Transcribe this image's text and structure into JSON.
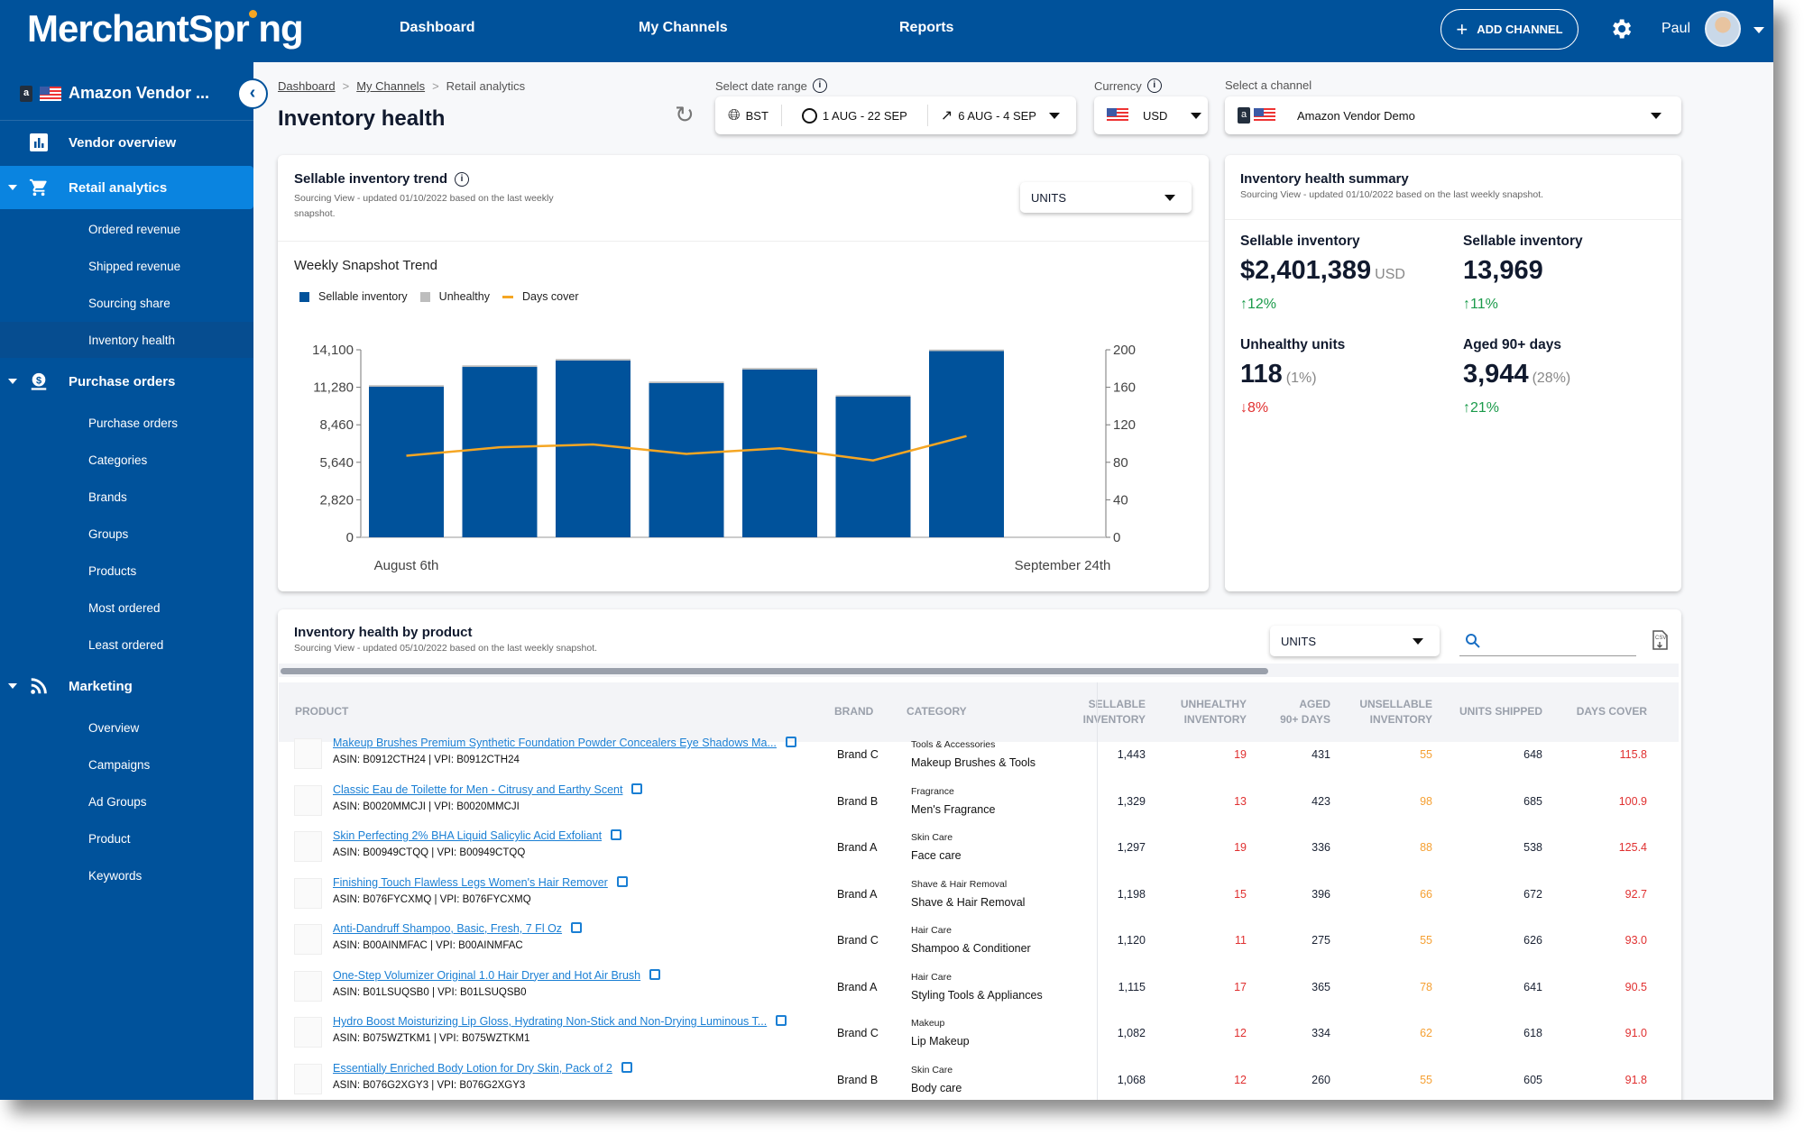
{
  "header": {
    "logo": "MerchantSpr ng",
    "nav": [
      "Dashboard",
      "My Channels",
      "Reports"
    ],
    "add_channel": "ADD CHANNEL",
    "user": "Paul"
  },
  "sidebar": {
    "channel": "Amazon Vendor ...",
    "sections": [
      {
        "label": "Vendor overview",
        "icon": "bar-chart-icon",
        "items": []
      },
      {
        "label": "Retail analytics",
        "icon": "cart-icon",
        "active": true,
        "items": [
          "Ordered revenue",
          "Shipped revenue",
          "Sourcing share",
          "Inventory health"
        ]
      },
      {
        "label": "Purchase orders",
        "icon": "money-bag-icon",
        "items": [
          "Purchase orders",
          "Categories",
          "Brands",
          "Groups",
          "Products",
          "Most ordered",
          "Least ordered"
        ]
      },
      {
        "label": "Marketing",
        "icon": "rss-icon",
        "items": [
          "Overview",
          "Campaigns",
          "Ad Groups",
          "Product",
          "Keywords"
        ]
      }
    ],
    "current_item": "Inventory health"
  },
  "breadcrumb": [
    "Dashboard",
    "My Channels",
    "Retail analytics"
  ],
  "page_title": "Inventory health",
  "filters": {
    "date_label": "Select date range",
    "timezone": "BST",
    "range": "1 AUG - 22 SEP",
    "compare": "6 AUG - 4 SEP",
    "currency_label": "Currency",
    "currency": "USD",
    "channel_label": "Select a channel",
    "channel": "Amazon Vendor Demo"
  },
  "trend_card": {
    "title": "Sellable inventory trend",
    "subtitle": "Sourcing View - updated 01/10/2022 based on the last weekly snapshot.",
    "units": "UNITS",
    "chart_title": "Weekly Snapshot Trend"
  },
  "chart_data": {
    "type": "bar",
    "title": "Weekly Snapshot Trend",
    "legend": [
      "Sellable inventory",
      "Unhealthy",
      "Days cover"
    ],
    "legend_position": "top-left",
    "categories": [
      "August 6th",
      "",
      "",
      "",
      "",
      "",
      "September 24th"
    ],
    "x_tick_labels": [
      "August 6th",
      "September 24th"
    ],
    "series": [
      {
        "name": "Sellable inventory",
        "type": "bar",
        "axis": "left",
        "values": [
          11320,
          12810,
          13290,
          11590,
          12610,
          10580,
          14000
        ]
      },
      {
        "name": "Unhealthy",
        "type": "bar",
        "axis": "left",
        "stacked": true,
        "values": [
          120,
          120,
          120,
          120,
          120,
          110,
          118
        ]
      },
      {
        "name": "Days cover",
        "type": "line",
        "axis": "right",
        "values": [
          87,
          96,
          99,
          89,
          95,
          82,
          108
        ]
      }
    ],
    "y_left": {
      "ticks": [
        0,
        2820,
        5640,
        8460,
        11280,
        14100
      ],
      "tick_labels": [
        "0",
        "2,820",
        "5,640",
        "8,460",
        "11,280",
        "14,100"
      ],
      "range": [
        0,
        14100
      ]
    },
    "y_right": {
      "ticks": [
        0,
        40,
        80,
        120,
        160,
        200
      ],
      "tick_labels": [
        "0",
        "40",
        "80",
        "120",
        "160",
        "200"
      ],
      "range": [
        0,
        200
      ]
    },
    "colors": {
      "Sellable inventory": "#00529b",
      "Unhealthy": "#bdbdbd",
      "Days cover": "#f5a623"
    },
    "grid": false
  },
  "summary": {
    "title": "Inventory health summary",
    "subtitle": "Sourcing View - updated 01/10/2022 based on the last weekly snapshot.",
    "kpis": [
      {
        "label": "Sellable inventory",
        "value": "$2,401,389",
        "unit": "USD",
        "change": "12%",
        "dir": "up"
      },
      {
        "label": "Sellable inventory",
        "value": "13,969",
        "unit": "",
        "change": "11%",
        "dir": "up"
      },
      {
        "label": "Unhealthy units",
        "value": "118",
        "unit": "(1%)",
        "change": "8%",
        "dir": "down"
      },
      {
        "label": "Aged 90+ days",
        "value": "3,944",
        "unit": "(28%)",
        "change": "21%",
        "dir": "up"
      }
    ]
  },
  "product_table": {
    "title": "Inventory health by product",
    "subtitle": "Sourcing View - updated 05/10/2022 based on the last weekly snapshot.",
    "units": "UNITS",
    "search_placeholder": "",
    "columns": [
      "PRODUCT",
      "BRAND",
      "CATEGORY",
      "SELLABLE INVENTORY",
      "UNHEALTHY INVENTORY",
      "AGED 90+ DAYS",
      "UNSELLABLE INVENTORY",
      "UNITS SHIPPED",
      "DAYS COVER"
    ],
    "columns_split": [
      [
        "PRODUCT"
      ],
      [
        "BRAND"
      ],
      [
        "CATEGORY"
      ],
      [
        "SELLABLE",
        "INVENTORY"
      ],
      [
        "UNHEALTHY",
        "INVENTORY"
      ],
      [
        "AGED",
        "90+ DAYS"
      ],
      [
        "UNSELLABLE",
        "INVENTORY"
      ],
      [
        "UNITS SHIPPED"
      ],
      [
        "DAYS COVER"
      ]
    ],
    "rows": [
      {
        "name": "Makeup Brushes Premium Synthetic Foundation Powder Concealers Eye Shadows Ma...",
        "ids": "ASIN: B0912CTH24 | VPI: B0912CTH24",
        "brand": "Brand C",
        "cat": "Tools & Accessories",
        "subcat": "Makeup Brushes & Tools",
        "sellable": "1,443",
        "unhealthy": "19",
        "aged": "431",
        "unsellable": "55",
        "shipped": "648",
        "cover": "115.8"
      },
      {
        "name": "Classic Eau de Toilette for Men - Citrusy and Earthy Scent",
        "ids": "ASIN: B0020MMCJI | VPI: B0020MMCJI",
        "brand": "Brand B",
        "cat": "Fragrance",
        "subcat": "Men's Fragrance",
        "sellable": "1,329",
        "unhealthy": "13",
        "aged": "423",
        "unsellable": "98",
        "shipped": "685",
        "cover": "100.9"
      },
      {
        "name": "Skin Perfecting 2% BHA Liquid Salicylic Acid Exfoliant",
        "ids": "ASIN: B00949CTQQ | VPI: B00949CTQQ",
        "brand": "Brand A",
        "cat": "Skin Care",
        "subcat": "Face care",
        "sellable": "1,297",
        "unhealthy": "19",
        "aged": "336",
        "unsellable": "88",
        "shipped": "538",
        "cover": "125.4"
      },
      {
        "name": "Finishing Touch Flawless Legs Women's Hair Remover",
        "ids": "ASIN: B076FYCXMQ | VPI: B076FYCXMQ",
        "brand": "Brand A",
        "cat": "Shave & Hair Removal",
        "subcat": "Shave & Hair Removal",
        "sellable": "1,198",
        "unhealthy": "15",
        "aged": "396",
        "unsellable": "66",
        "shipped": "672",
        "cover": "92.7"
      },
      {
        "name": "Anti-Dandruff Shampoo, Basic, Fresh, 7 Fl Oz",
        "ids": "ASIN: B00AINMFAC | VPI: B00AINMFAC",
        "brand": "Brand C",
        "cat": "Hair Care",
        "subcat": "Shampoo & Conditioner",
        "sellable": "1,120",
        "unhealthy": "11",
        "aged": "275",
        "unsellable": "55",
        "shipped": "626",
        "cover": "93.0"
      },
      {
        "name": "One-Step Volumizer Original 1.0 Hair Dryer and Hot Air Brush",
        "ids": "ASIN: B01LSUQSB0 | VPI: B01LSUQSB0",
        "brand": "Brand A",
        "cat": "Hair Care",
        "subcat": "Styling Tools & Appliances",
        "sellable": "1,115",
        "unhealthy": "17",
        "aged": "365",
        "unsellable": "78",
        "shipped": "641",
        "cover": "90.5"
      },
      {
        "name": "Hydro Boost Moisturizing Lip Gloss, Hydrating Non-Stick and Non-Drying Luminous T...",
        "ids": "ASIN: B075WZTKM1 | VPI: B075WZTKM1",
        "brand": "Brand C",
        "cat": "Makeup",
        "subcat": "Lip Makeup",
        "sellable": "1,082",
        "unhealthy": "12",
        "aged": "334",
        "unsellable": "62",
        "shipped": "618",
        "cover": "91.0"
      },
      {
        "name": "Essentially Enriched Body Lotion for Dry Skin, Pack of 2",
        "ids": "ASIN: B076G2XGY3 | VPI: B076G2XGY3",
        "brand": "Brand B",
        "cat": "Skin Care",
        "subcat": "Body care",
        "sellable": "1,068",
        "unhealthy": "12",
        "aged": "260",
        "unsellable": "55",
        "shipped": "605",
        "cover": "91.8"
      }
    ]
  }
}
